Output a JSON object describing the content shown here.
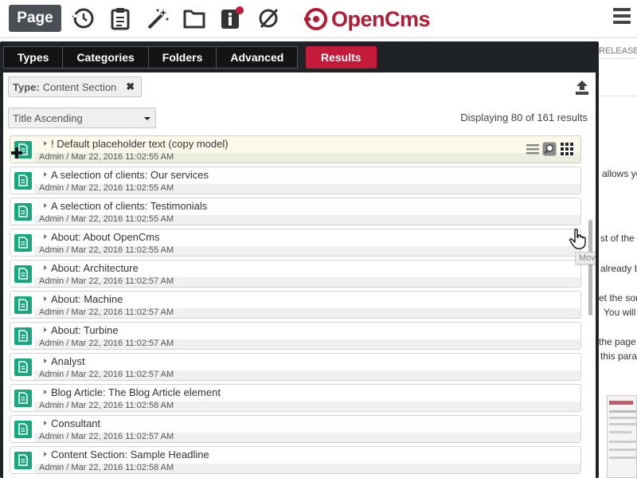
{
  "toolbar": {
    "page_label": "Page",
    "icons": [
      "history-icon",
      "clipboard-icon",
      "magic-wand-icon",
      "folder-icon",
      "info-icon",
      "disabled-eye-icon"
    ],
    "logo_text": "OpenCms",
    "brand_color": "#b31b34"
  },
  "background_page": {
    "release_text": "RELEASE",
    "snippets": [
      "allows yo",
      "st of the",
      "already be",
      "et the sor",
      "You will",
      "the page.",
      "this para"
    ]
  },
  "gallery": {
    "tabs": [
      "Types",
      "Categories",
      "Folders",
      "Advanced"
    ],
    "results_tab": "Results",
    "accent_color": "#c41a3a",
    "filter": {
      "key": "Type:",
      "value": "Content Section",
      "remove": "✖"
    },
    "sort": {
      "selected": "Title Ascending"
    },
    "result_count": "Displaying 80 of 161 results",
    "tooltip": "Move to page",
    "items": [
      {
        "title": "! Default placeholder text (copy model)",
        "meta": "Admin / Mar 22, 2016 11:02:55 AM"
      },
      {
        "title": "A selection of clients: Our services",
        "meta": "Admin / Mar 22, 2016 11:02:55 AM"
      },
      {
        "title": "A selection of clients: Testimonials",
        "meta": "Admin / Mar 22, 2016 11:02:55 AM"
      },
      {
        "title": "About: About OpenCms",
        "meta": "Admin / Mar 22, 2016 11:02:55 AM"
      },
      {
        "title": "About: Architecture",
        "meta": "Admin / Mar 22, 2016 11:02:57 AM"
      },
      {
        "title": "About: Machine",
        "meta": "Admin / Mar 22, 2016 11:02:57 AM"
      },
      {
        "title": "About: Turbine",
        "meta": "Admin / Mar 22, 2016 11:02:57 AM"
      },
      {
        "title": "Analyst",
        "meta": "Admin / Mar 22, 2016 11:02:57 AM"
      },
      {
        "title": "Blog Article: The Blog Article element",
        "meta": "Admin / Mar 22, 2016 11:02:58 AM"
      },
      {
        "title": "Consultant",
        "meta": "Admin / Mar 22, 2016 11:02:57 AM"
      },
      {
        "title": "Content Section: Sample Headline",
        "meta": "Admin / Mar 22, 2016 11:02:58 AM"
      }
    ]
  }
}
